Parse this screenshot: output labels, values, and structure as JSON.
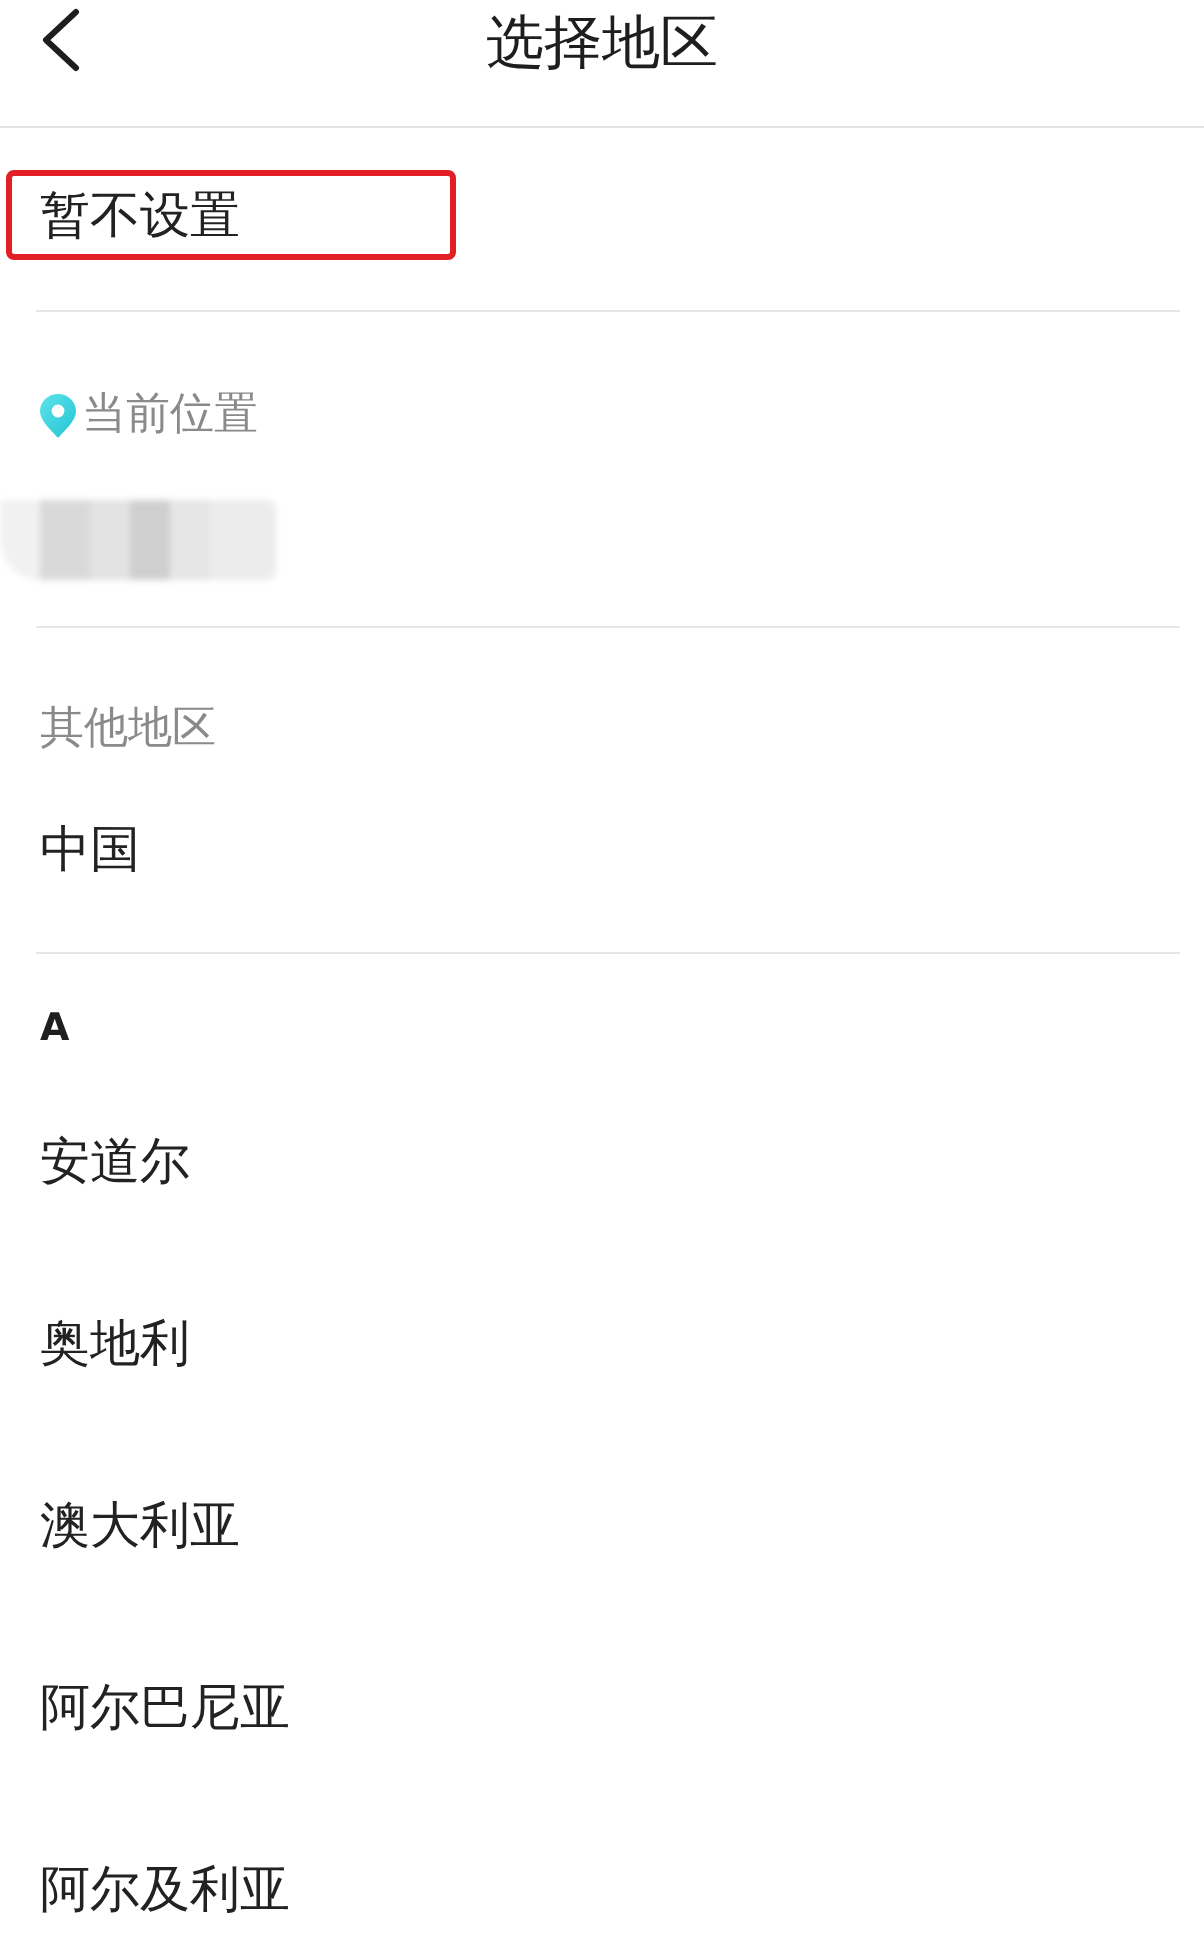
{
  "header": {
    "title": "选择地区"
  },
  "skip_option": {
    "label": "暂不设置",
    "highlighted": true
  },
  "current_location": {
    "label": "当前位置",
    "blurred": true
  },
  "other_regions": {
    "label": "其他地区",
    "items": [
      "中国"
    ]
  },
  "sections": [
    {
      "letter": "A",
      "regions": [
        "安道尔",
        "奥地利",
        "澳大利亚",
        "阿尔巴尼亚",
        "阿尔及利亚"
      ]
    }
  ]
}
